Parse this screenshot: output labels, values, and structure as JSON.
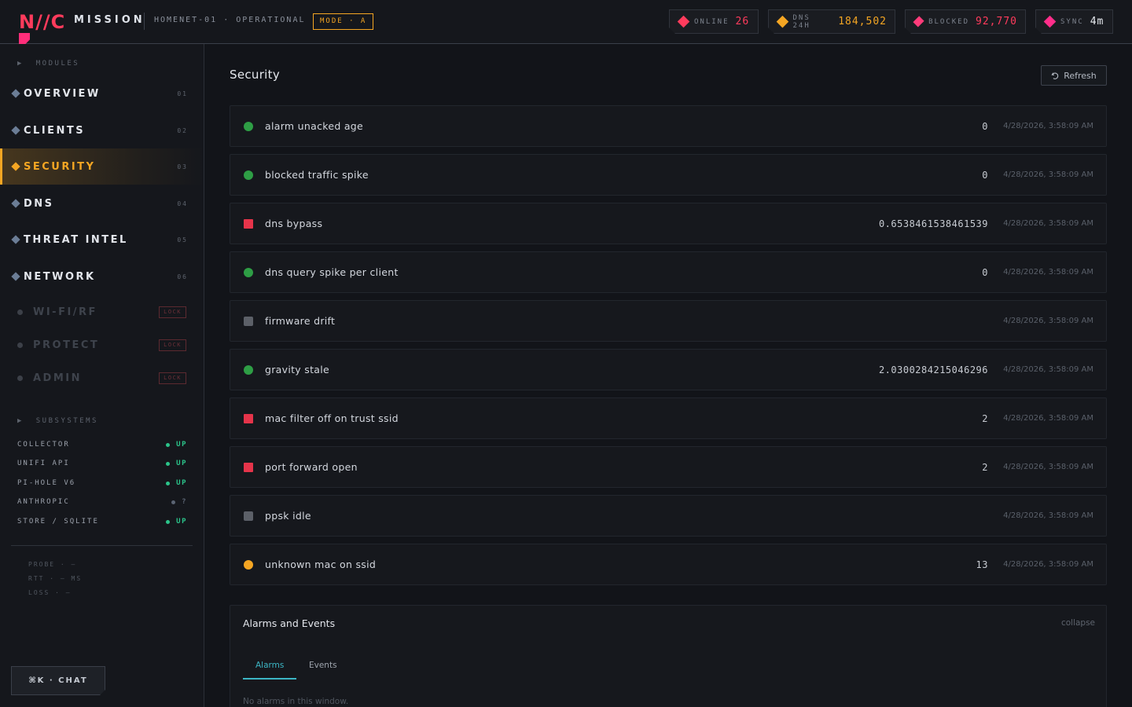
{
  "header": {
    "logo": "N//C",
    "title": "MISSION",
    "network_status": "HOMENET-01 · OPERATIONAL",
    "mode": "MODE · A",
    "stats": [
      {
        "label": "ONLINE",
        "value": "26",
        "color": "#ff3b5c"
      },
      {
        "label": "DNS 24H",
        "value": "184,502",
        "color": "#f5a623"
      },
      {
        "label": "BLOCKED",
        "value": "92,770",
        "color": "#ff3b5c"
      },
      {
        "label": "SYNC",
        "value": "4m",
        "color": "#e8ebf0"
      }
    ]
  },
  "sidebar": {
    "modules_label": "MODULES",
    "nav": [
      {
        "label": "OVERVIEW",
        "num": "01"
      },
      {
        "label": "CLIENTS",
        "num": "02"
      },
      {
        "label": "SECURITY",
        "num": "03"
      },
      {
        "label": "DNS",
        "num": "04"
      },
      {
        "label": "THREAT INTEL",
        "num": "05"
      },
      {
        "label": "NETWORK",
        "num": "06"
      }
    ],
    "active_nav": "SECURITY",
    "locked": [
      {
        "label": "WI-FI/RF",
        "tag": "LOCK"
      },
      {
        "label": "PROTECT",
        "tag": "LOCK"
      },
      {
        "label": "ADMIN",
        "tag": "LOCK"
      }
    ],
    "subsystems_label": "SUBSYSTEMS",
    "subsystems": [
      {
        "name": "COLLECTOR",
        "status": "UP",
        "color": "#2bc48a"
      },
      {
        "name": "UNIFI API",
        "status": "UP",
        "color": "#2bc48a"
      },
      {
        "name": "PI-HOLE V6",
        "status": "UP",
        "color": "#2bc48a"
      },
      {
        "name": "ANTHROPIC",
        "status": "?",
        "color": "#5b6473"
      },
      {
        "name": "STORE / SQLITE",
        "status": "UP",
        "color": "#2bc48a"
      }
    ],
    "probe": [
      "PROBE · —",
      "RTT · — MS",
      "LOSS · —"
    ],
    "chat_button": "⌘K · CHAT"
  },
  "main": {
    "title": "Security",
    "refresh": "Refresh",
    "checks": [
      {
        "name": "alarm unacked age",
        "value": "0",
        "time": "4/28/2026, 3:58:09 AM",
        "status": "ok"
      },
      {
        "name": "blocked traffic spike",
        "value": "0",
        "time": "4/28/2026, 3:58:09 AM",
        "status": "ok"
      },
      {
        "name": "dns bypass",
        "value": "0.6538461538461539",
        "time": "4/28/2026, 3:58:09 AM",
        "status": "bad"
      },
      {
        "name": "dns query spike per client",
        "value": "0",
        "time": "4/28/2026, 3:58:09 AM",
        "status": "ok"
      },
      {
        "name": "firmware drift",
        "value": "",
        "time": "4/28/2026, 3:58:09 AM",
        "status": "unk"
      },
      {
        "name": "gravity stale",
        "value": "2.0300284215046296",
        "time": "4/28/2026, 3:58:09 AM",
        "status": "ok"
      },
      {
        "name": "mac filter off on trust ssid",
        "value": "2",
        "time": "4/28/2026, 3:58:09 AM",
        "status": "bad"
      },
      {
        "name": "port forward open",
        "value": "2",
        "time": "4/28/2026, 3:58:09 AM",
        "status": "bad"
      },
      {
        "name": "ppsk idle",
        "value": "",
        "time": "4/28/2026, 3:58:09 AM",
        "status": "unk"
      },
      {
        "name": "unknown mac on ssid",
        "value": "13",
        "time": "4/28/2026, 3:58:09 AM",
        "status": "warn"
      }
    ],
    "alarms": {
      "title": "Alarms and Events",
      "collapse": "collapse",
      "tabs": [
        "Alarms",
        "Events"
      ],
      "active_tab": "Alarms",
      "empty": "No alarms in this window."
    }
  }
}
